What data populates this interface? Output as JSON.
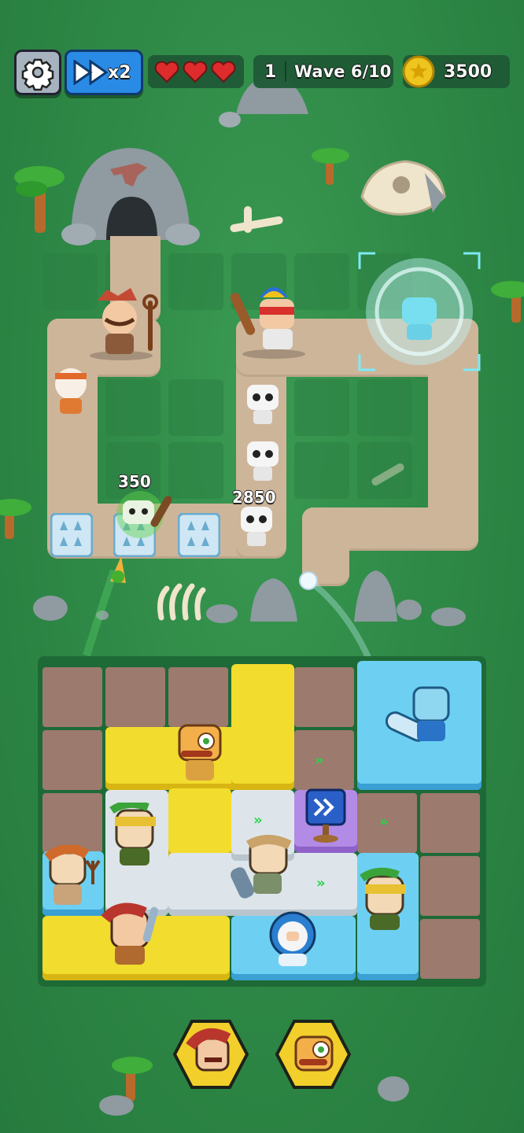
{
  "hud": {
    "settings_icon": "gear-icon",
    "speed_label": "x2",
    "speed_icon": "fast-forward-icon",
    "lives": [
      true,
      true,
      true
    ],
    "heart_color": "#e8262b",
    "level": "1",
    "wave_label": "Wave 6/10",
    "coins": "3500",
    "coin_icon": "coin-star-icon"
  },
  "damage_numbers": [
    "350",
    "2850"
  ],
  "board": {
    "move_arrow_glyph": "»",
    "block_colors": {
      "yellow": "#f2dc2d",
      "blue": "#6dd0f2",
      "gray": "#dde5ea",
      "purple": "#b28be6"
    }
  },
  "shop": {
    "slots": [
      "caveman-hunter-icon",
      "cyclops-mechanic-icon"
    ]
  }
}
